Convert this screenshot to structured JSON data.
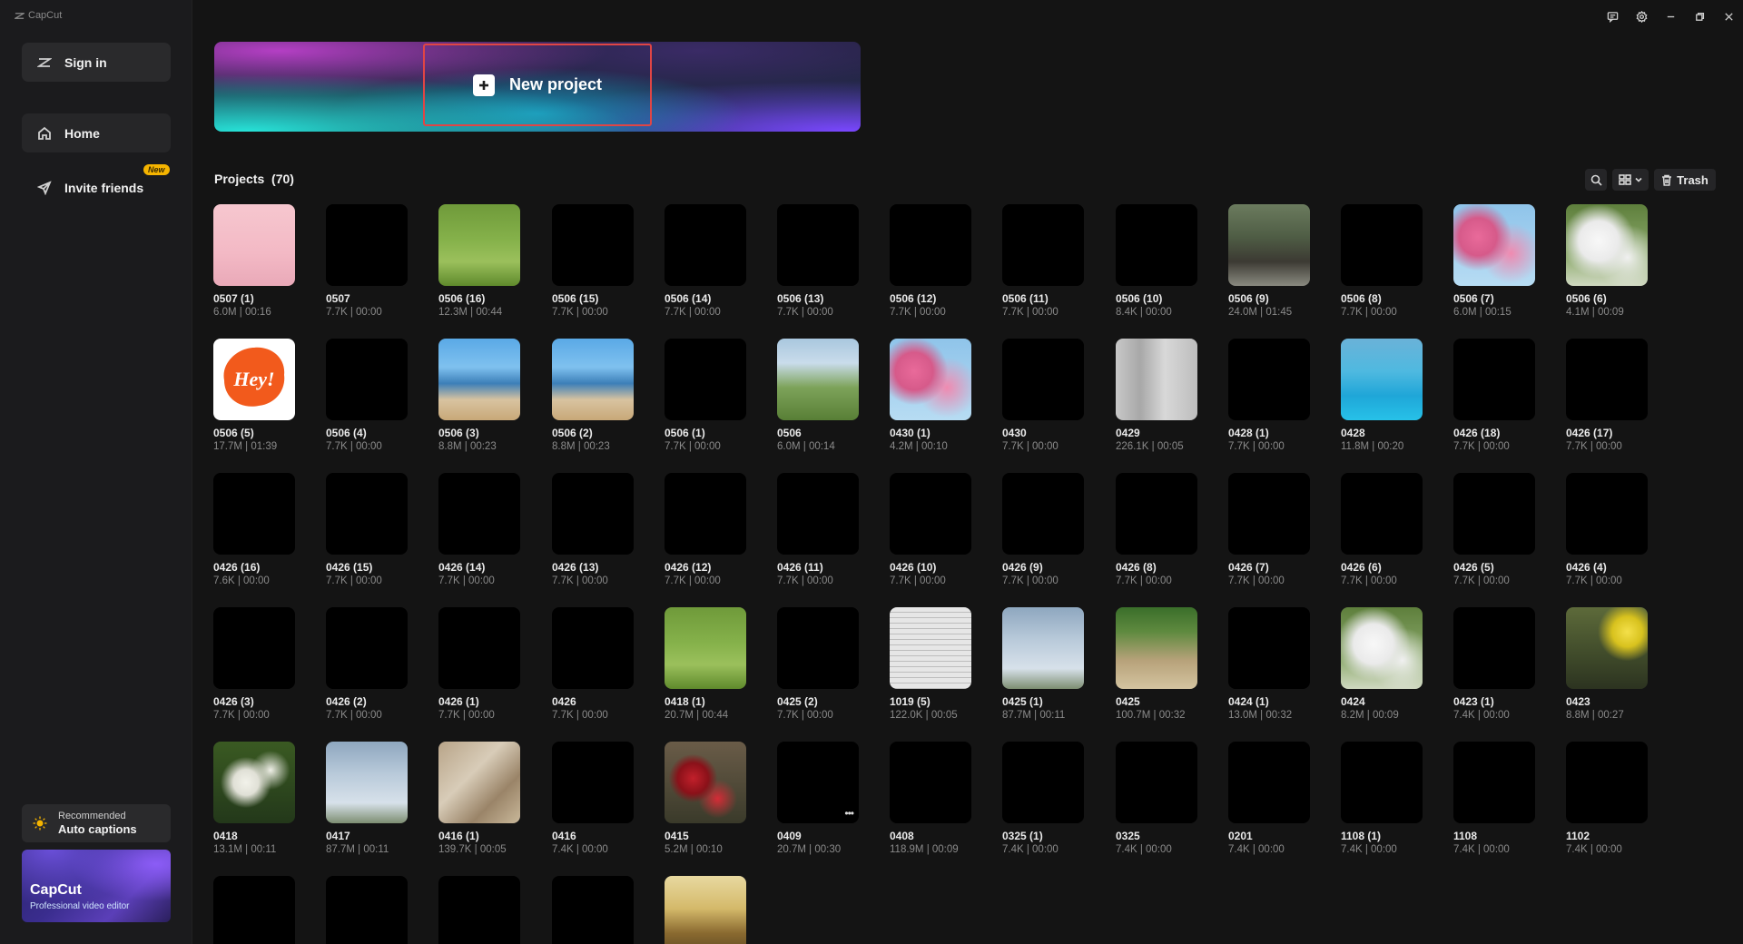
{
  "app": {
    "logo_text": "CapCut"
  },
  "sidebar": {
    "signin_label": "Sign in",
    "home_label": "Home",
    "invite_label": "Invite friends",
    "new_badge": "New",
    "recommend_small": "Recommended",
    "recommend_big": "Auto captions",
    "promo_title": "CapCut",
    "promo_sub": "Professional video editor"
  },
  "banner": {
    "new_project_label": "New project"
  },
  "projects": {
    "title": "Projects",
    "count": "(70)",
    "trash_label": "Trash",
    "items": [
      {
        "name": "0507 (1)",
        "meta": "6.0M | 00:16",
        "thumb": "girls"
      },
      {
        "name": "0507",
        "meta": "7.7K | 00:00",
        "thumb": "black"
      },
      {
        "name": "0506 (16)",
        "meta": "12.3M | 00:44",
        "thumb": "cat"
      },
      {
        "name": "0506 (15)",
        "meta": "7.7K | 00:00",
        "thumb": "black"
      },
      {
        "name": "0506 (14)",
        "meta": "7.7K | 00:00",
        "thumb": "black"
      },
      {
        "name": "0506 (13)",
        "meta": "7.7K | 00:00",
        "thumb": "black"
      },
      {
        "name": "0506 (12)",
        "meta": "7.7K | 00:00",
        "thumb": "black"
      },
      {
        "name": "0506 (11)",
        "meta": "7.7K | 00:00",
        "thumb": "black"
      },
      {
        "name": "0506 (10)",
        "meta": "8.4K | 00:00",
        "thumb": "black"
      },
      {
        "name": "0506 (9)",
        "meta": "24.0M | 01:45",
        "thumb": "people"
      },
      {
        "name": "0506 (8)",
        "meta": "7.7K | 00:00",
        "thumb": "black"
      },
      {
        "name": "0506 (7)",
        "meta": "6.0M | 00:15",
        "thumb": "blossom"
      },
      {
        "name": "0506 (6)",
        "meta": "4.1M | 00:09",
        "thumb": "whiteflower"
      },
      {
        "name": "0506 (5)",
        "meta": "17.7M | 01:39",
        "thumb": "hey"
      },
      {
        "name": "0506 (4)",
        "meta": "7.7K | 00:00",
        "thumb": "black"
      },
      {
        "name": "0506 (3)",
        "meta": "8.8M | 00:23",
        "thumb": "beach"
      },
      {
        "name": "0506 (2)",
        "meta": "8.8M | 00:23",
        "thumb": "beach"
      },
      {
        "name": "0506 (1)",
        "meta": "7.7K | 00:00",
        "thumb": "black"
      },
      {
        "name": "0506",
        "meta": "6.0M | 00:14",
        "thumb": "girlsfield"
      },
      {
        "name": "0430 (1)",
        "meta": "4.2M | 00:10",
        "thumb": "blossom"
      },
      {
        "name": "0430",
        "meta": "7.7K | 00:00",
        "thumb": "black"
      },
      {
        "name": "0429",
        "meta": "226.1K | 00:05",
        "thumb": "woman"
      },
      {
        "name": "0428 (1)",
        "meta": "7.7K | 00:00",
        "thumb": "black"
      },
      {
        "name": "0428",
        "meta": "11.8M | 00:20",
        "thumb": "pool"
      },
      {
        "name": "0426 (18)",
        "meta": "7.7K | 00:00",
        "thumb": "black"
      },
      {
        "name": "0426 (17)",
        "meta": "7.7K | 00:00",
        "thumb": "black"
      },
      {
        "name": "0426 (16)",
        "meta": "7.6K | 00:00",
        "thumb": "black"
      },
      {
        "name": "0426 (15)",
        "meta": "7.7K | 00:00",
        "thumb": "black"
      },
      {
        "name": "0426 (14)",
        "meta": "7.7K | 00:00",
        "thumb": "black"
      },
      {
        "name": "0426 (13)",
        "meta": "7.7K | 00:00",
        "thumb": "black"
      },
      {
        "name": "0426 (12)",
        "meta": "7.7K | 00:00",
        "thumb": "black"
      },
      {
        "name": "0426 (11)",
        "meta": "7.7K | 00:00",
        "thumb": "black"
      },
      {
        "name": "0426 (10)",
        "meta": "7.7K | 00:00",
        "thumb": "black"
      },
      {
        "name": "0426 (9)",
        "meta": "7.7K | 00:00",
        "thumb": "black"
      },
      {
        "name": "0426 (8)",
        "meta": "7.7K | 00:00",
        "thumb": "black"
      },
      {
        "name": "0426 (7)",
        "meta": "7.7K | 00:00",
        "thumb": "black"
      },
      {
        "name": "0426 (6)",
        "meta": "7.7K | 00:00",
        "thumb": "black"
      },
      {
        "name": "0426 (5)",
        "meta": "7.7K | 00:00",
        "thumb": "black"
      },
      {
        "name": "0426 (4)",
        "meta": "7.7K | 00:00",
        "thumb": "black"
      },
      {
        "name": "0426 (3)",
        "meta": "7.7K | 00:00",
        "thumb": "black"
      },
      {
        "name": "0426 (2)",
        "meta": "7.7K | 00:00",
        "thumb": "black"
      },
      {
        "name": "0426 (1)",
        "meta": "7.7K | 00:00",
        "thumb": "black"
      },
      {
        "name": "0426",
        "meta": "7.7K | 00:00",
        "thumb": "black"
      },
      {
        "name": "0418 (1)",
        "meta": "20.7M | 00:44",
        "thumb": "cat"
      },
      {
        "name": "0425 (2)",
        "meta": "7.7K | 00:00",
        "thumb": "black"
      },
      {
        "name": "1019 (5)",
        "meta": "122.0K | 00:05",
        "thumb": "document"
      },
      {
        "name": "0425 (1)",
        "meta": "87.7M | 00:11",
        "thumb": "sky"
      },
      {
        "name": "0425",
        "meta": "100.7M | 00:32",
        "thumb": "hiker"
      },
      {
        "name": "0424 (1)",
        "meta": "13.0M | 00:32",
        "thumb": "black"
      },
      {
        "name": "0424",
        "meta": "8.2M | 00:09",
        "thumb": "whiteflower"
      },
      {
        "name": "0423 (1)",
        "meta": "7.4K | 00:00",
        "thumb": "black"
      },
      {
        "name": "0423",
        "meta": "8.8M | 00:27",
        "thumb": "daffodil"
      },
      {
        "name": "0418",
        "meta": "13.1M | 00:11",
        "thumb": "yarrow"
      },
      {
        "name": "0417",
        "meta": "87.7M | 00:11",
        "thumb": "sky"
      },
      {
        "name": "0416 (1)",
        "meta": "139.7K | 00:05",
        "thumb": "food"
      },
      {
        "name": "0416",
        "meta": "7.4K | 00:00",
        "thumb": "black"
      },
      {
        "name": "0415",
        "meta": "5.2M | 00:10",
        "thumb": "cherries"
      },
      {
        "name": "0409",
        "meta": "20.7M | 00:30",
        "thumb": "blackdots"
      },
      {
        "name": "0408",
        "meta": "118.9M | 00:09",
        "thumb": "black"
      },
      {
        "name": "0325 (1)",
        "meta": "7.4K | 00:00",
        "thumb": "black"
      },
      {
        "name": "0325",
        "meta": "7.4K | 00:00",
        "thumb": "black"
      },
      {
        "name": "0201",
        "meta": "7.4K | 00:00",
        "thumb": "black"
      },
      {
        "name": "1108 (1)",
        "meta": "7.4K | 00:00",
        "thumb": "black"
      },
      {
        "name": "1108",
        "meta": "7.4K | 00:00",
        "thumb": "black"
      },
      {
        "name": "1102",
        "meta": "7.4K | 00:00",
        "thumb": "black"
      },
      {
        "name": "",
        "meta": "",
        "thumb": "black"
      },
      {
        "name": "",
        "meta": "",
        "thumb": "black"
      },
      {
        "name": "",
        "meta": "",
        "thumb": "black"
      },
      {
        "name": "",
        "meta": "",
        "thumb": "black"
      },
      {
        "name": "",
        "meta": "",
        "thumb": "car"
      }
    ]
  }
}
